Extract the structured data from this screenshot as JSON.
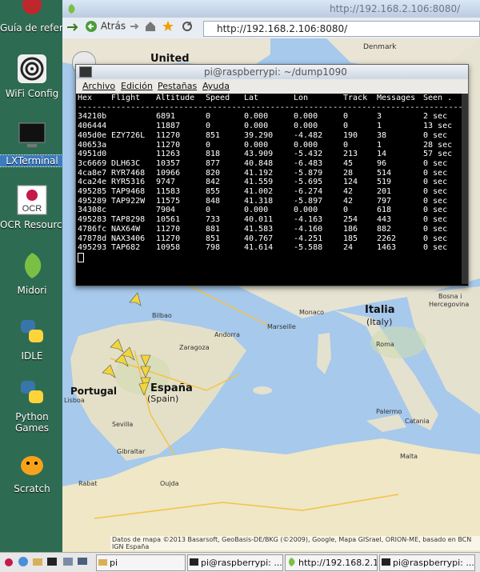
{
  "desktop": {
    "icons": [
      {
        "name": "guia-de-referencia-icon",
        "label": "Guía de referencia ..."
      },
      {
        "name": "wifi-config-icon",
        "label": "WiFi Config"
      },
      {
        "name": "lxterminal-icon",
        "label": "LXTerminal"
      },
      {
        "name": "ocr-resources-icon",
        "label": "OCR Resources"
      },
      {
        "name": "midori-icon",
        "label": "Midori"
      },
      {
        "name": "idle-icon",
        "label": "IDLE"
      },
      {
        "name": "python-games-icon",
        "label": "Python Games"
      },
      {
        "name": "scratch-icon",
        "label": "Scratch"
      }
    ]
  },
  "browser": {
    "title": "http://192.168.2.106:8080/",
    "back_label": "Atrás",
    "url": "http://192.168.2.106:8080/"
  },
  "map": {
    "labels": {
      "united": "United",
      "denmark": "Denmark",
      "italia": "Italia",
      "italy": "(Italy)",
      "espana": "España",
      "spain": "(Spain)",
      "portugal": "Portugal",
      "bilbao": "Bilbao",
      "andorra": "Andorra",
      "marseille": "Marseille",
      "monaco": "Monaco",
      "zaragoza": "Zaragoza",
      "lisboa": "Lisboa",
      "sevilla": "Sevilla",
      "gibraltar": "Gibraltar",
      "palermo": "Palermo",
      "catania": "Catania",
      "malta": "Malta",
      "rabat": "Rabat",
      "oujda": "Oujda",
      "roma": "Roma",
      "bosna": "Bosna i",
      "hercegovina": "Hercegovina"
    },
    "credits": "Datos de mapa ©2013 Basarsoft, GeoBasis-DE/BKG (©2009), Google, Mapa GISrael, ORION-ME, basado en BCN IGN España"
  },
  "terminal": {
    "title": "pi@raspberrypi: ~/dump1090",
    "menu": [
      "Archivo",
      "Edición",
      "Pestañas",
      "Ayuda"
    ],
    "headers": [
      "Hex",
      "Flight",
      "Altitude",
      "Speed",
      "Lat",
      "Lon",
      "Track",
      "Messages",
      "Seen ."
    ],
    "separator": "--------------------------------------------------------------------------------",
    "rows": [
      [
        "34210b",
        "",
        "6891",
        "0",
        "0.000",
        "0.000",
        "0",
        "3",
        "2 sec"
      ],
      [
        "406444",
        "",
        "11887",
        "0",
        "0.000",
        "0.000",
        "0",
        "1",
        "13 sec"
      ],
      [
        "405d0e",
        "EZY726L",
        "11270",
        "851",
        "39.290",
        "-4.482",
        "190",
        "38",
        "0 sec"
      ],
      [
        "40653a",
        "",
        "11270",
        "0",
        "0.000",
        "0.000",
        "0",
        "1",
        "28 sec"
      ],
      [
        "4951d0",
        "",
        "11263",
        "818",
        "43.909",
        "-5.432",
        "213",
        "14",
        "57 sec"
      ],
      [
        "3c6669",
        "DLH63C",
        "10357",
        "877",
        "40.848",
        "-6.483",
        "45",
        "96",
        "0 sec"
      ],
      [
        "4ca8e7",
        "RYR7468",
        "10966",
        "820",
        "41.192",
        "-5.879",
        "28",
        "514",
        "0 sec"
      ],
      [
        "4ca24e",
        "RYR5316",
        "9747",
        "842",
        "41.559",
        "-5.695",
        "124",
        "519",
        "0 sec"
      ],
      [
        "495285",
        "TAP9468",
        "11583",
        "855",
        "41.002",
        "-6.274",
        "42",
        "201",
        "0 sec"
      ],
      [
        "495289",
        "TAP922W",
        "11575",
        "848",
        "41.318",
        "-5.897",
        "42",
        "797",
        "0 sec"
      ],
      [
        "34308c",
        "",
        "7904",
        "0",
        "0.000",
        "0.000",
        "0",
        "618",
        "0 sec"
      ],
      [
        "495283",
        "TAP8298",
        "10561",
        "733",
        "40.011",
        "-4.163",
        "254",
        "443",
        "0 sec"
      ],
      [
        "4786fc",
        "NAX64W",
        "11270",
        "881",
        "41.583",
        "-4.160",
        "186",
        "882",
        "0 sec"
      ],
      [
        "47878d",
        "NAX3406",
        "11270",
        "851",
        "40.767",
        "-4.251",
        "185",
        "2262",
        "0 sec"
      ],
      [
        "495293",
        "TAP682",
        "10958",
        "798",
        "41.614",
        "-5.588",
        "24",
        "1463",
        "0 sec"
      ]
    ]
  },
  "taskbar": {
    "tasks": [
      "pi",
      "pi@raspberrypi: ...",
      "http://192.168.2.1...",
      "pi@raspberrypi: ..."
    ]
  }
}
